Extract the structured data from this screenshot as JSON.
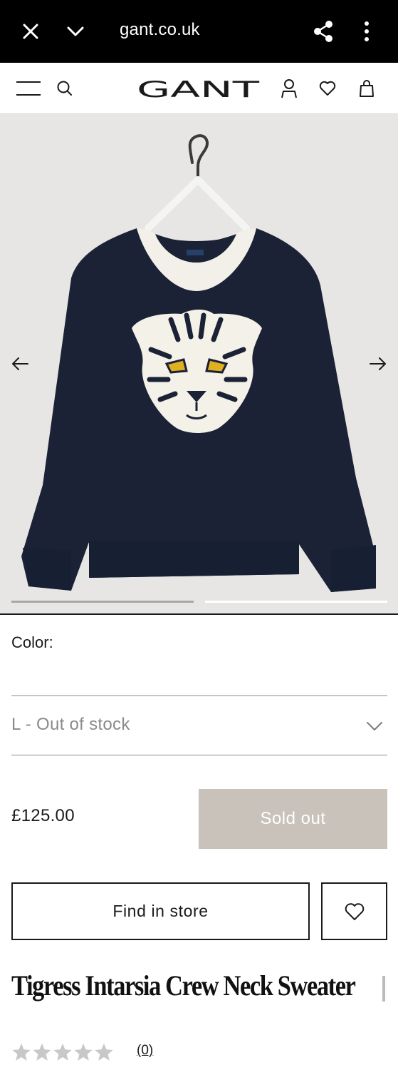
{
  "browser": {
    "url": "gant.co.uk",
    "icons": [
      "close-icon",
      "chevron-down-icon",
      "share-icon",
      "more-vertical-icon"
    ]
  },
  "header": {
    "logo_text": "GANT",
    "icons": [
      "menu-icon",
      "search-icon",
      "account-icon",
      "wishlist-icon",
      "bag-icon"
    ]
  },
  "gallery": {
    "image": "navy crew neck sweater with white tiger face intarsia on a hanger",
    "prev_icon": "arrow-left-icon",
    "next_icon": "arrow-right-icon",
    "slide_count": 2,
    "active_slide": 2
  },
  "product": {
    "color_label": "Color:",
    "size_value": "L - Out of stock",
    "price": "£125.00",
    "sold_out_label": "Sold out",
    "find_store_label": "Find in store",
    "title": "Tigress Intarsia Crew Neck Sweater",
    "rating": 0,
    "rating_max": 5,
    "review_count": "(0)"
  },
  "colors": {
    "browser_bar": "#000000",
    "sold_out_bg": "#c8c2bb",
    "sweater_navy": "#1b2236",
    "image_bg": "#e7e6e4",
    "star_empty": "#c8c8c8",
    "tiger_eye": "#e0b020"
  }
}
